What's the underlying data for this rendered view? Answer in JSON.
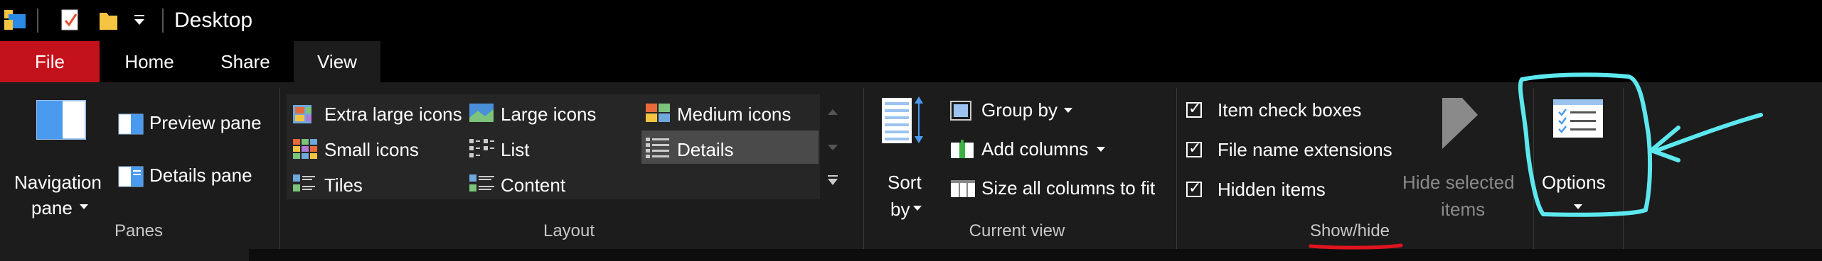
{
  "window": {
    "title": "Desktop"
  },
  "tabs": {
    "file": "File",
    "home": "Home",
    "share": "Share",
    "view": "View"
  },
  "panes": {
    "navigation_label_1": "Navigation",
    "navigation_label_2": "pane",
    "preview": "Preview pane",
    "details": "Details pane",
    "group": "Panes"
  },
  "layout": {
    "items": [
      "Extra large icons",
      "Large icons",
      "Medium icons",
      "Small icons",
      "List",
      "Details",
      "Tiles",
      "Content"
    ],
    "selected": "Details",
    "group": "Layout"
  },
  "current_view": {
    "sort_1": "Sort",
    "sort_2": "by",
    "group_by": "Group by",
    "add_columns": "Add columns",
    "size_columns": "Size all columns to fit",
    "group": "Current view"
  },
  "show_hide": {
    "item_check_boxes": "Item check boxes",
    "file_name_extensions": "File name extensions",
    "hidden_items": "Hidden items",
    "hide_selected_1": "Hide selected",
    "hide_selected_2": "items",
    "group": "Show/hide",
    "checked": [
      true,
      true,
      true
    ]
  },
  "options": {
    "label": "Options"
  },
  "colors": {
    "file_tab": "#c4121c",
    "ribbon_bg": "#1c1c1c",
    "annotation_cyan": "#5ce8ee",
    "annotation_red": "#e0141e"
  }
}
